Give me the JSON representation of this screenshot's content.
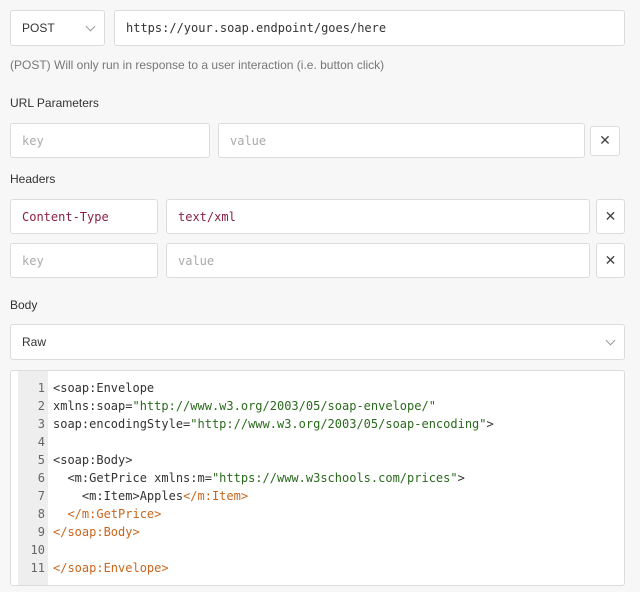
{
  "request": {
    "method": "POST",
    "url": "https://your.soap.endpoint/goes/here",
    "note": "(POST) Will only run in response to a user interaction (i.e. button click)"
  },
  "url_params": {
    "title": "URL Parameters",
    "rows": [
      {
        "key": "",
        "value": "",
        "key_placeholder": "key",
        "value_placeholder": "value"
      }
    ]
  },
  "headers": {
    "title": "Headers",
    "rows": [
      {
        "key": "Content-Type",
        "value": "text/xml"
      },
      {
        "key": "",
        "value": "",
        "key_placeholder": "key",
        "value_placeholder": "value"
      }
    ]
  },
  "body": {
    "title": "Body",
    "mode": "Raw",
    "code_lines": [
      {
        "num": "1",
        "parts": [
          {
            "c": "t-tag",
            "t": "<soap:Envelope"
          }
        ]
      },
      {
        "num": "2",
        "parts": [
          {
            "c": "t-tag",
            "t": "xmlns:soap="
          },
          {
            "c": "t-str",
            "t": "\"http://www.w3.org/2003/05/soap-envelope/\""
          }
        ]
      },
      {
        "num": "3",
        "parts": [
          {
            "c": "t-tag",
            "t": "soap:encodingStyle="
          },
          {
            "c": "t-str",
            "t": "\"http://www.w3.org/2003/05/soap-encoding\""
          },
          {
            "c": "t-tag",
            "t": ">"
          }
        ]
      },
      {
        "num": "4",
        "parts": []
      },
      {
        "num": "5",
        "parts": [
          {
            "c": "t-tag",
            "t": "<soap:Body>"
          }
        ]
      },
      {
        "num": "6",
        "parts": [
          {
            "c": "t-tag",
            "t": "  <m:GetPrice xmlns:m="
          },
          {
            "c": "t-str",
            "t": "\"https://www.w3schools.com/prices\""
          },
          {
            "c": "t-tag",
            "t": ">"
          }
        ]
      },
      {
        "num": "7",
        "parts": [
          {
            "c": "t-tag",
            "t": "    <m:Item>"
          },
          {
            "c": "t-text",
            "t": "Apples"
          },
          {
            "c": "t-close",
            "t": "</m:Item>"
          }
        ]
      },
      {
        "num": "8",
        "parts": [
          {
            "c": "t-close",
            "t": "  </m:GetPrice>"
          }
        ]
      },
      {
        "num": "9",
        "parts": [
          {
            "c": "t-close",
            "t": "</soap:Body>"
          }
        ]
      },
      {
        "num": "10",
        "parts": []
      },
      {
        "num": "11",
        "parts": [
          {
            "c": "t-close",
            "t": "</soap:Envelope>"
          }
        ]
      }
    ]
  },
  "icons": {
    "remove": "close-icon",
    "dropdown": "chevron-down-icon"
  }
}
